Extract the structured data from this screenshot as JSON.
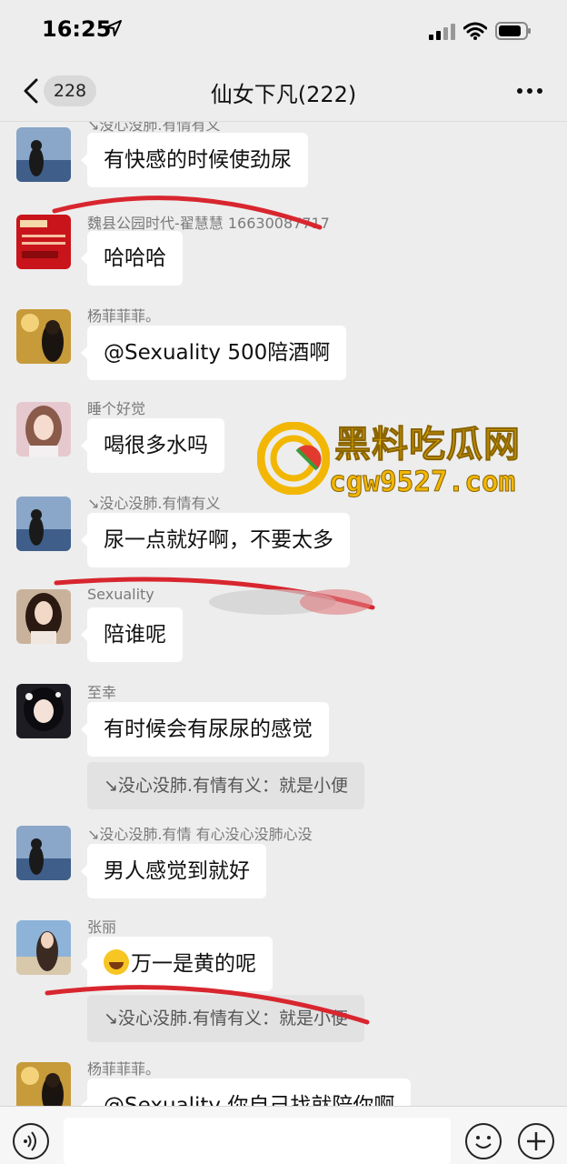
{
  "status_bar": {
    "time": "16:25"
  },
  "nav": {
    "unread_count": "228",
    "title": "仙女下凡(222)"
  },
  "messages": [
    {
      "sender": "↘没心没肺.有情有义",
      "text": "有快感的时候使劲尿"
    },
    {
      "sender": "魏县公园时代-翟慧慧 16630087717",
      "text": "哈哈哈"
    },
    {
      "sender": "杨菲菲菲。",
      "text": "@Sexuality 500陪酒啊"
    },
    {
      "sender": "睡个好觉",
      "text": "喝很多水吗"
    },
    {
      "sender": "↘没心没肺.有情有义",
      "text": "尿一点就好啊，不要太多"
    },
    {
      "sender": "Sexuality",
      "text": "陪谁呢"
    },
    {
      "sender": "至幸",
      "text": "有时候会有尿尿的感觉",
      "quote": "↘没心没肺.有情有义：就是小便"
    },
    {
      "sender": "↘没心没肺.有情 有心没心没肺心没",
      "text": "男人感觉到就好"
    },
    {
      "sender": "张丽",
      "text": "万一是黄的呢",
      "quote": "↘没心没肺.有情有义：就是小便",
      "emoji": "laughing-tears"
    },
    {
      "sender": "杨菲菲菲。",
      "text": "@Sexuality 你自己找就陪你啊"
    }
  ],
  "watermark": {
    "title": "黑料吃瓜网",
    "url": "cgw9527.com"
  },
  "colors": {
    "background": "#ededed",
    "bubble": "#ffffff",
    "annotation_red": "#d8262f",
    "watermark": "#f2b705"
  },
  "icons": [
    "location-arrow-icon",
    "signal-icon",
    "wifi-icon",
    "battery-icon",
    "back-chevron-icon",
    "more-dots-icon",
    "voice-icon",
    "emoji-icon",
    "add-icon"
  ]
}
